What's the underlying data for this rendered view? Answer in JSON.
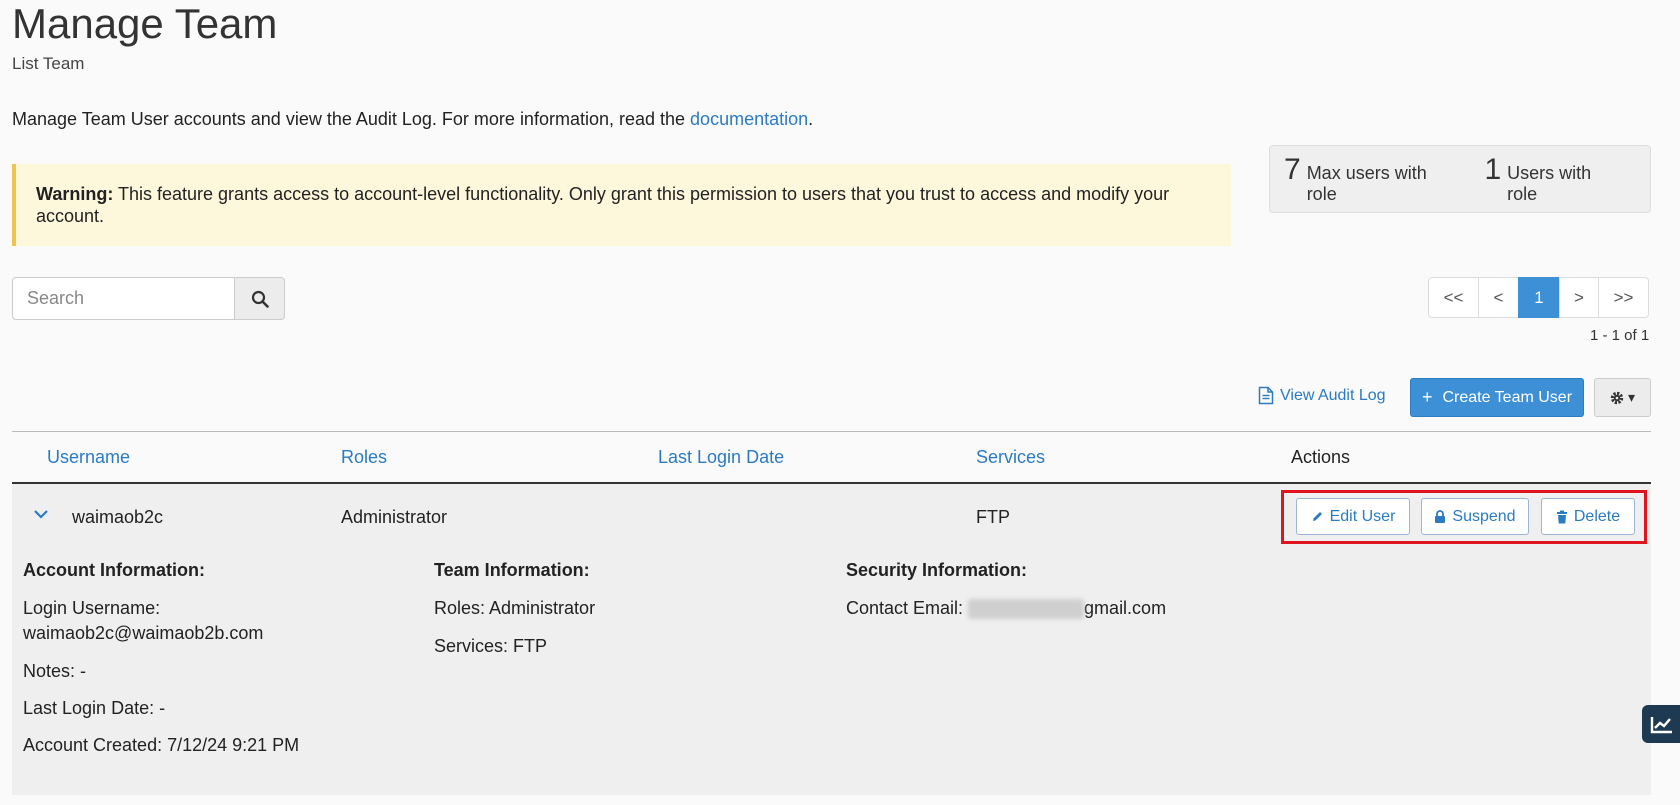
{
  "header": {
    "title": "Manage Team",
    "subtitle": "List Team",
    "intro_text": "Manage Team User accounts and view the Audit Log. For more information, read the ",
    "intro_link": "documentation",
    "intro_end": "."
  },
  "warning": {
    "label": "Warning:",
    "text": " This feature grants access to account-level functionality. Only grant this permission to users that you trust to access and modify your account."
  },
  "stats": {
    "max_users_value": "7",
    "max_users_label": "Max users with role",
    "users_value": "1",
    "users_label": "Users with role"
  },
  "search": {
    "placeholder": "Search",
    "icon": "search-icon"
  },
  "pagination": {
    "first": "<<",
    "prev": "<",
    "current": "1",
    "next": ">",
    "last": ">>",
    "range": "1 - 1 of 1"
  },
  "toolbar": {
    "audit_label": "View Audit Log",
    "create_label": "Create Team User",
    "create_icon": "+",
    "gear_caret": "▾"
  },
  "table": {
    "columns": {
      "username": "Username",
      "roles": "Roles",
      "last_login": "Last Login Date",
      "services": "Services",
      "actions": "Actions"
    },
    "row": {
      "username": "waimaob2c",
      "roles": "Administrator",
      "last_login": "",
      "services": "FTP",
      "actions": {
        "edit": "Edit User",
        "suspend": "Suspend",
        "delete": "Delete"
      }
    },
    "details": {
      "account": {
        "heading": "Account Information:",
        "login_label": "Login Username:",
        "login_value": "waimaob2c@waimaob2b.com",
        "notes": "Notes: -",
        "last_login": "Last Login Date: -",
        "created": "Account Created: 7/12/24 9:21 PM"
      },
      "team": {
        "heading": "Team Information:",
        "roles": "Roles: Administrator",
        "services": "Services: FTP"
      },
      "security": {
        "heading": "Security Information:",
        "email_label": "Contact Email: ",
        "email_domain": "gmail.com"
      }
    }
  },
  "colors": {
    "accent": "#3d8fd6",
    "link": "#2a7bc4",
    "warning_bg": "#fdf7dc",
    "highlight": "#e0141e"
  }
}
